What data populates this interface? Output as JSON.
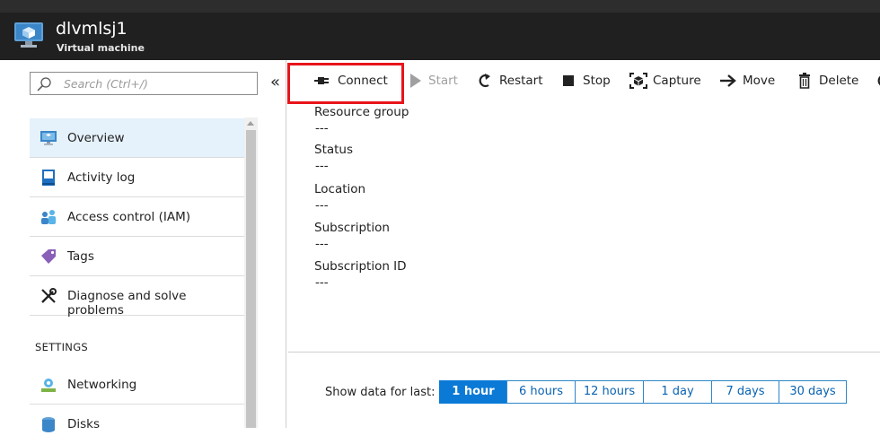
{
  "header": {
    "title": "dlvmlsj1",
    "subtitle": "Virtual machine"
  },
  "sidebar": {
    "search_placeholder": "Search (Ctrl+/)",
    "collapse_glyph": "«",
    "items": [
      {
        "label": "Overview",
        "icon": "monitor-icon",
        "active": true
      },
      {
        "label": "Activity log",
        "icon": "book-icon"
      },
      {
        "label": "Access control (IAM)",
        "icon": "people-icon"
      },
      {
        "label": "Tags",
        "icon": "tag-icon"
      },
      {
        "label": "Diagnose and solve problems",
        "icon": "wrench-icon"
      }
    ],
    "settings_header": "SETTINGS",
    "settings_items": [
      {
        "label": "Networking",
        "icon": "network-icon"
      },
      {
        "label": "Disks",
        "icon": "disk-icon"
      }
    ]
  },
  "toolbar": {
    "connect": "Connect",
    "start": "Start",
    "restart": "Restart",
    "stop": "Stop",
    "capture": "Capture",
    "move": "Move",
    "delete": "Delete"
  },
  "properties": [
    {
      "label": "Resource group",
      "value": "---"
    },
    {
      "label": "Status",
      "value": "---"
    },
    {
      "label": "Location",
      "value": "---"
    },
    {
      "label": "Subscription",
      "value": "---"
    },
    {
      "label": "Subscription ID",
      "value": "---"
    }
  ],
  "timerange": {
    "label": "Show data for last:",
    "options": [
      "1 hour",
      "6 hours",
      "12 hours",
      "1 day",
      "7 days",
      "30 days"
    ],
    "selected": "1 hour"
  },
  "colors": {
    "highlight": "#e8151b",
    "accent": "#0a7ad6",
    "header_bg": "#202020"
  }
}
